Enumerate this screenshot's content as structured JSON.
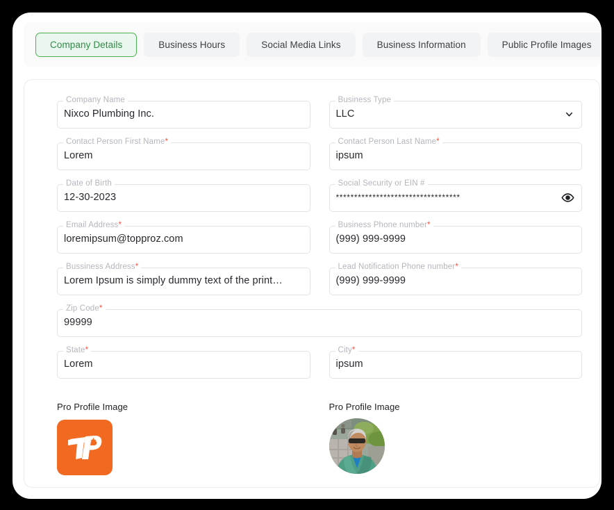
{
  "tabs": [
    {
      "label": "Company Details",
      "active": true
    },
    {
      "label": "Business Hours",
      "active": false
    },
    {
      "label": "Social Media Links",
      "active": false
    },
    {
      "label": "Business Information",
      "active": false
    },
    {
      "label": "Public Profile Images",
      "active": false
    },
    {
      "label": "",
      "active": false
    }
  ],
  "form": {
    "company_name": {
      "label": "Company Name",
      "required": false,
      "value": "Nixco Plumbing Inc."
    },
    "business_type": {
      "label": "Business Type",
      "required": false,
      "value": "LLC",
      "icon": "chevron-down-icon"
    },
    "first_name": {
      "label": "Contact Person First Name",
      "required": true,
      "value": "Lorem"
    },
    "last_name": {
      "label": "Contact Person Last Name",
      "required": true,
      "value": "ipsum"
    },
    "date_of_birth": {
      "label": "Date of Birth",
      "required": false,
      "value": "12-30-2023"
    },
    "ssn_ein": {
      "label": "Social Security or EIN #",
      "required": false,
      "value": "**********************************",
      "icon": "eye-icon"
    },
    "email": {
      "label": "Email Address",
      "required": true,
      "value": "loremipsum@topproz.com"
    },
    "business_phone": {
      "label": "Business Phone number",
      "required": true,
      "value": "(999) 999-9999"
    },
    "business_address": {
      "label": "Bussiness Address",
      "required": true,
      "value": "Lorem Ipsum is simply dummy text of the printing and typ…"
    },
    "lead_phone": {
      "label": "Lead Notification Phone number",
      "required": true,
      "value": "(999) 999-9999"
    },
    "zip_code": {
      "label": "Zip Code",
      "required": true,
      "value": "99999"
    },
    "state": {
      "label": "State",
      "required": true,
      "value": "Lorem"
    },
    "city": {
      "label": "City",
      "required": true,
      "value": "ipsum"
    }
  },
  "images": {
    "logo": {
      "caption": "Pro Profile Image",
      "type": "logo-tile",
      "monogram": "TP",
      "background": "#f26a21",
      "foreground": "#ffffff"
    },
    "photo": {
      "caption": "Pro Profile Image",
      "type": "avatar-photo"
    }
  },
  "colors": {
    "accent_green": "#4caf50",
    "active_tab_bg": "#eaf7ee",
    "active_tab_text": "#2e8b46",
    "required_asterisk": "#f4503c",
    "field_border": "#e2e3e7",
    "label_grey": "#b3b6bd",
    "value_text": "#26282d",
    "window_bg": "#ffffff",
    "outer_bg": "#000000"
  }
}
